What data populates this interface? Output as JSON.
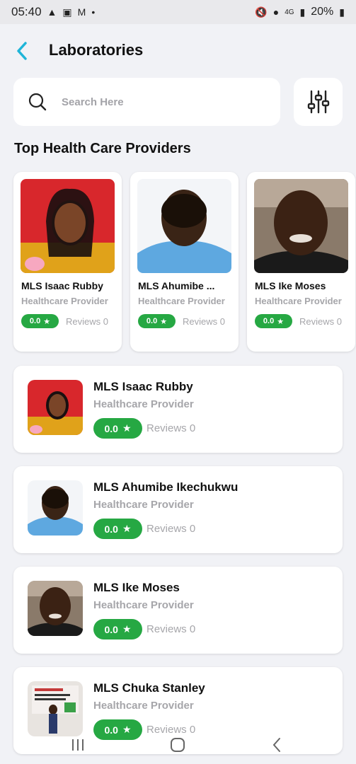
{
  "status_bar": {
    "time": "05:40",
    "battery": "20%",
    "network": "4G"
  },
  "header": {
    "title": "Laboratories"
  },
  "search": {
    "placeholder": "Search Here"
  },
  "section": {
    "title": "Top Health Care Providers"
  },
  "top_providers": [
    {
      "name": "MLS Isaac Rubby",
      "role": "Healthcare Provider",
      "rating": "0.0",
      "reviews": "Reviews 0"
    },
    {
      "name": "MLS Ahumibe ...",
      "role": "Healthcare Provider",
      "rating": "0.0",
      "reviews": "Reviews 0"
    },
    {
      "name": "MLS Ike Moses",
      "role": "Healthcare Provider",
      "rating": "0.0",
      "reviews": "Reviews 0"
    }
  ],
  "providers": [
    {
      "name": "MLS Isaac Rubby",
      "role": "Healthcare Provider",
      "rating": "0.0",
      "reviews": "Reviews 0"
    },
    {
      "name": "MLS Ahumibe Ikechukwu",
      "role": "Healthcare Provider",
      "rating": "0.0",
      "reviews": "Reviews 0"
    },
    {
      "name": "MLS Ike Moses",
      "role": "Healthcare Provider",
      "rating": "0.0",
      "reviews": "Reviews 0"
    },
    {
      "name": "MLS Chuka Stanley",
      "role": "Healthcare Provider",
      "rating": "0.0",
      "reviews": "Reviews 0"
    }
  ],
  "colors": {
    "accent": "#26a843",
    "back": "#1fb5d8",
    "background": "#f1f2f6"
  }
}
